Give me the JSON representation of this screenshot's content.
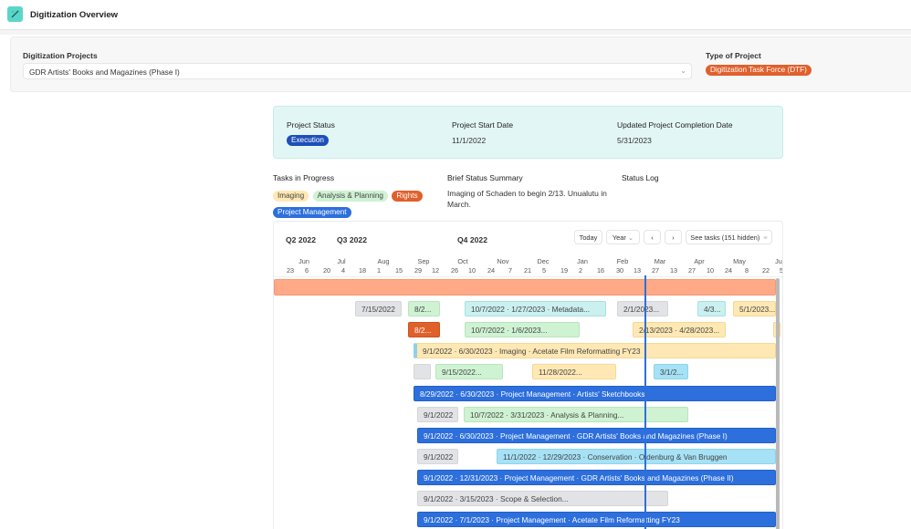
{
  "header": {
    "app_icon": "magic-wand-icon",
    "title": "Digitization Overview",
    "title_chevron": "chevron-down-icon"
  },
  "filters": {
    "projects_label": "Digitization Projects",
    "projects_value": "GDR Artists' Books and Magazines (Phase I)",
    "type_label": "Type of Project",
    "type_value": "Digitization Task Force (DTF)",
    "type_color": "#e0602c"
  },
  "status": {
    "project_status_label": "Project Status",
    "project_status_value": "Execution",
    "start_label": "Project Start Date",
    "start_value": "11/1/2022",
    "completion_label": "Updated Project Completion Date",
    "completion_value": "5/31/2023"
  },
  "info": {
    "tasks_label": "Tasks in Progress",
    "tasks": [
      {
        "label": "Imaging",
        "color": "#ffe8b4"
      },
      {
        "label": "Analysis & Planning",
        "color": "#cff2d3"
      },
      {
        "label": "Rights",
        "color": "#e0602c"
      },
      {
        "label": "Project Management",
        "color": "#2d6fdc"
      }
    ],
    "summary_label": "Brief Status Summary",
    "summary_text": "Imaging of Schaden to begin 2/13. Unualutu in March.",
    "log_label": "Status Log"
  },
  "timeline": {
    "quarters": [
      "Q2 2022",
      "Q3 2022",
      "Q4 2022"
    ],
    "toolbar": {
      "today": "Today",
      "range": "Year",
      "prev": "‹",
      "next": "›",
      "see_tasks": "See tasks (151 hidden)"
    },
    "months": [
      "Jun",
      "Jul",
      "Aug",
      "Sep",
      "Oct",
      "Nov",
      "Dec",
      "Jan",
      "Feb",
      "Mar",
      "Apr",
      "May",
      "Jun"
    ],
    "days": [
      "23",
      "6",
      "20",
      "4",
      "18",
      "1",
      "15",
      "29",
      "12",
      "26",
      "10",
      "24",
      "7",
      "21",
      "5",
      "19",
      "2",
      "16",
      "30",
      "13",
      "27",
      "13",
      "27",
      "10",
      "24",
      "8",
      "22",
      "5"
    ],
    "bars": [
      {
        "row": 0,
        "start": 0,
        "end": 550,
        "color": "salmon",
        "label": ""
      },
      {
        "row": 1,
        "start": 89,
        "end": 140,
        "color": "gray",
        "label": "7/15/2022"
      },
      {
        "row": 1,
        "start": 147,
        "end": 182,
        "color": "green",
        "label": "8/2..."
      },
      {
        "row": 1,
        "start": 209,
        "end": 364,
        "color": "teal",
        "label": "10/7/2022 · 1/27/2023 · Metadata..."
      },
      {
        "row": 1,
        "start": 376,
        "end": 432,
        "color": "gray",
        "label": "2/1/2023..."
      },
      {
        "row": 1,
        "start": 464,
        "end": 495,
        "color": "teal",
        "label": "4/3..."
      },
      {
        "row": 1,
        "start": 503,
        "end": 550,
        "color": "yellow",
        "label": "5/1/2023..."
      },
      {
        "row": 2,
        "start": 147,
        "end": 182,
        "color": "orange",
        "label": "8/2..."
      },
      {
        "row": 2,
        "start": 209,
        "end": 335,
        "color": "green",
        "label": "10/7/2022 · 1/6/2023..."
      },
      {
        "row": 2,
        "start": 393,
        "end": 495,
        "color": "yellow",
        "label": "2/13/2023 · 4/28/2023..."
      },
      {
        "row": 2,
        "start": 547,
        "end": 550,
        "color": "yellow",
        "label": ""
      },
      {
        "row": 3,
        "start": 153,
        "end": 550,
        "color": "yellow",
        "label": "9/1/2022 · 6/30/2023 · Imaging · Acetate Film Reformatting FY23",
        "accent": true
      },
      {
        "row": 4,
        "start": 153,
        "end": 172,
        "color": "gray",
        "label": ""
      },
      {
        "row": 4,
        "start": 177,
        "end": 251,
        "color": "green",
        "label": "9/15/2022..."
      },
      {
        "row": 4,
        "start": 283,
        "end": 375,
        "color": "yellow",
        "label": "11/28/2022..."
      },
      {
        "row": 4,
        "start": 416,
        "end": 454,
        "color": "sky",
        "label": "3/1/2..."
      },
      {
        "row": 5,
        "start": 153,
        "end": 550,
        "color": "blue",
        "label": "8/29/2022 · 6/30/2023 · Project Management · Artists' Sketchbooks"
      },
      {
        "row": 6,
        "start": 157,
        "end": 202,
        "color": "gray",
        "label": "9/1/2022"
      },
      {
        "row": 6,
        "start": 208,
        "end": 454,
        "color": "green",
        "label": "10/7/2022 · 3/31/2023 · Analysis & Planning..."
      },
      {
        "row": 7,
        "start": 157,
        "end": 550,
        "color": "blue",
        "label": "9/1/2022 · 6/30/2023 · Project Management · GDR Artists' Books and Magazines (Phase I)"
      },
      {
        "row": 8,
        "start": 157,
        "end": 202,
        "color": "gray",
        "label": "9/1/2022"
      },
      {
        "row": 8,
        "start": 244,
        "end": 550,
        "color": "sky",
        "label": "11/1/2022 · 12/29/2023 · Conservation · Oldenburg & Van Bruggen"
      },
      {
        "row": 9,
        "start": 157,
        "end": 550,
        "color": "blue",
        "label": "9/1/2022 · 12/31/2023 · Project Management · GDR Artists' Books and Magazines (Phase II)"
      },
      {
        "row": 10,
        "start": 157,
        "end": 432,
        "color": "gray",
        "label": "9/1/2022 · 3/15/2023 · Scope & Selection..."
      },
      {
        "row": 11,
        "start": 157,
        "end": 550,
        "color": "blue",
        "label": "9/1/2022 · 7/1/2023 · Project Management · Acetate Film Reformatting FY23"
      }
    ]
  }
}
